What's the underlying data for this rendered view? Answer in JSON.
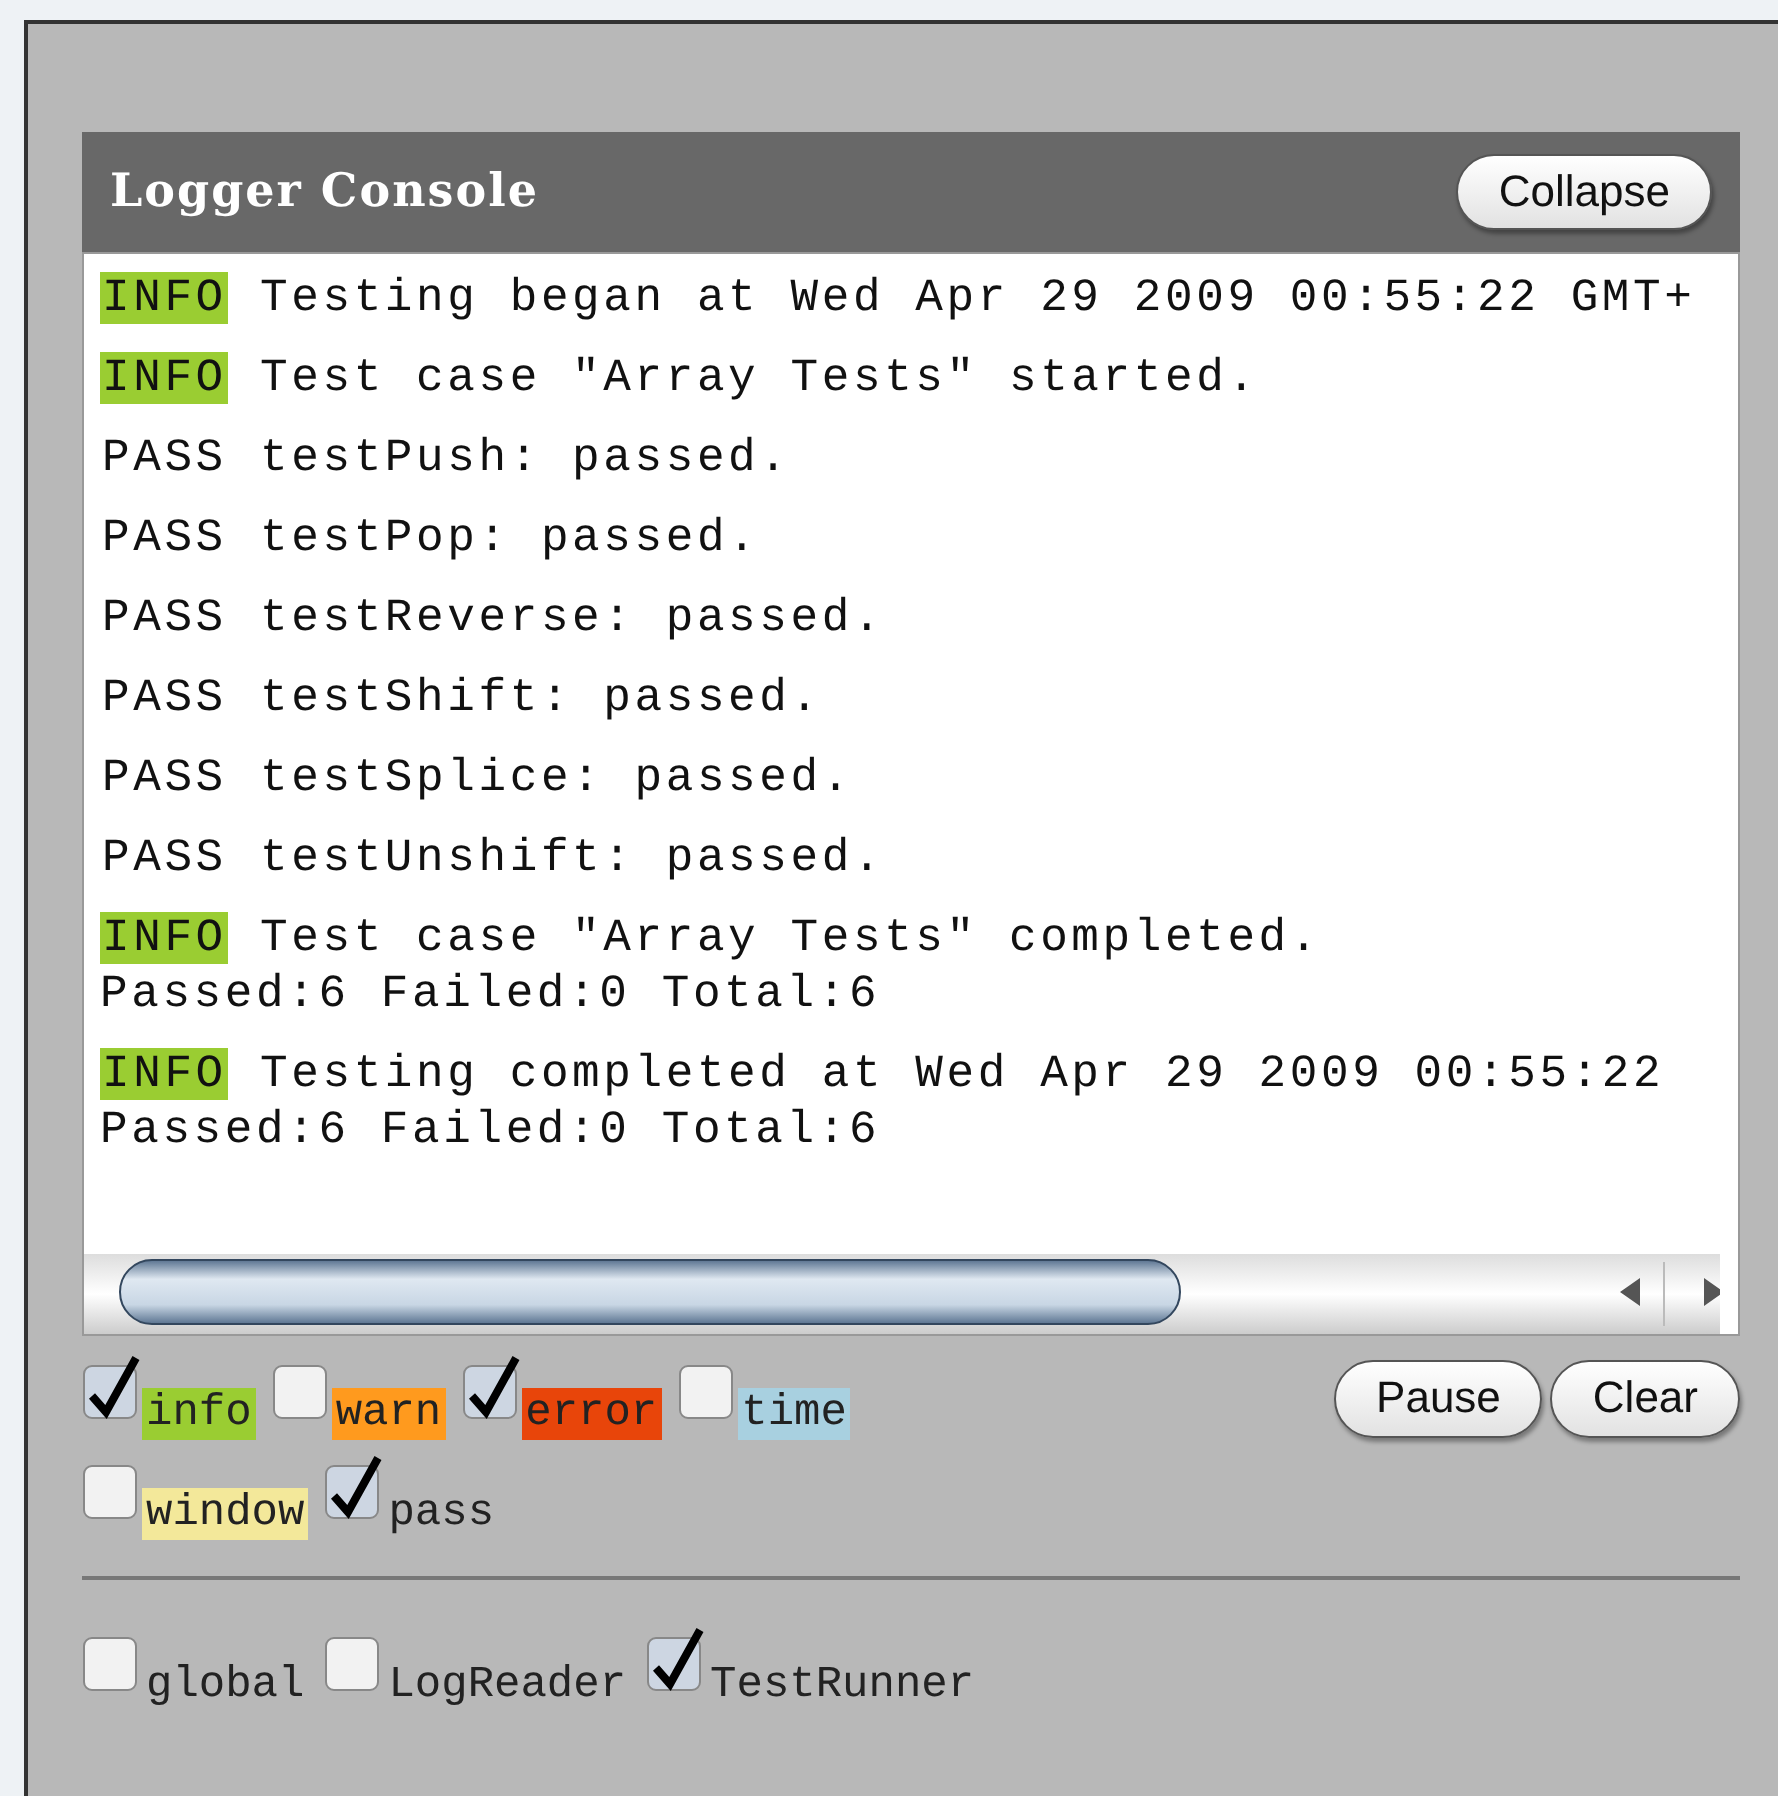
{
  "console": {
    "title": "Logger Console",
    "collapse_button": "Collapse",
    "entries": [
      {
        "category": "INFO",
        "kind": "info",
        "text": "Testing began at Wed Apr 29 2009 00:55:22 GMT+"
      },
      {
        "category": "INFO",
        "kind": "info",
        "text": "Test case \"Array Tests\" started."
      },
      {
        "category": "PASS",
        "kind": "pass",
        "text": "testPush: passed."
      },
      {
        "category": "PASS",
        "kind": "pass",
        "text": "testPop: passed."
      },
      {
        "category": "PASS",
        "kind": "pass",
        "text": "testReverse: passed."
      },
      {
        "category": "PASS",
        "kind": "pass",
        "text": "testShift: passed."
      },
      {
        "category": "PASS",
        "kind": "pass",
        "text": "testSplice: passed."
      },
      {
        "category": "PASS",
        "kind": "pass",
        "text": "testUnshift: passed."
      },
      {
        "category": "INFO",
        "kind": "info",
        "text": "Test case \"Array Tests\" completed.",
        "detail": "Passed:6 Failed:0 Total:6"
      },
      {
        "category": "INFO",
        "kind": "info",
        "text": "Testing completed at Wed Apr 29 2009 00:55:22",
        "detail": "Passed:6 Failed:0 Total:6"
      }
    ],
    "category_filters": [
      {
        "label": "info",
        "checked": true,
        "color": "#9acd32"
      },
      {
        "label": "warn",
        "checked": false,
        "color": "#ff9a1e"
      },
      {
        "label": "error",
        "checked": true,
        "color": "#e8450a"
      },
      {
        "label": "time",
        "checked": false,
        "color": "#a8d0e0"
      },
      {
        "label": "window",
        "checked": false,
        "color": "#f3e89a"
      },
      {
        "label": "pass",
        "checked": true
      }
    ],
    "buttons": [
      "Pause",
      "Clear"
    ],
    "source_filters": [
      {
        "label": "global",
        "checked": false
      },
      {
        "label": "LogReader",
        "checked": false
      },
      {
        "label": "TestRunner",
        "checked": true
      }
    ]
  }
}
